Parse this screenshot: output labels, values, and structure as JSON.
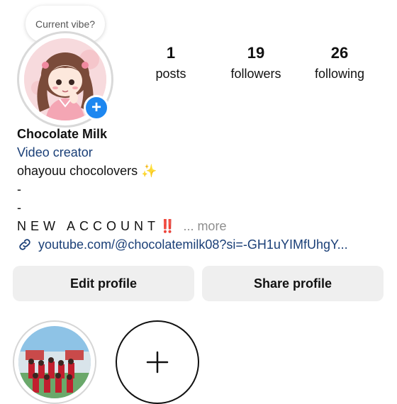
{
  "profile": {
    "note": "Current vibe?",
    "add_story_symbol": "+",
    "stats": [
      {
        "value": "1",
        "label": "posts"
      },
      {
        "value": "19",
        "label": "followers"
      },
      {
        "value": "26",
        "label": "following"
      }
    ],
    "name": "Chocolate Milk",
    "category": "Video creator",
    "bio_line1": "ohayouu chocolovers ✨",
    "bio_line2": "-",
    "bio_line3": "-",
    "bio_line4": "NEW ACCOUNT‼️",
    "bio_more": "... more",
    "link": "youtube.com/@chocolatemilk08?si=-GH1uYIMfUhgY..."
  },
  "buttons": {
    "edit_profile": "Edit profile",
    "share_profile": "Share profile"
  },
  "icons": {
    "add_badge": "plus-icon",
    "link": "link-icon",
    "new_highlight": "plus-icon"
  },
  "colors": {
    "accent_blue": "#1d87f0",
    "link_blue": "#1a3f77",
    "button_bg": "#efefef"
  }
}
